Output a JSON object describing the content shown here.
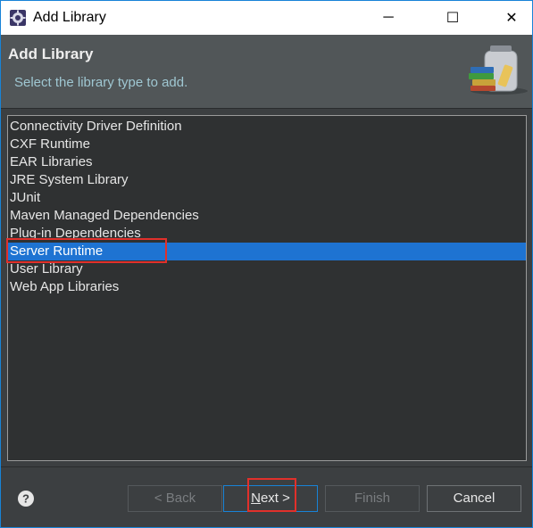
{
  "window": {
    "title": "Add Library",
    "min_glyph": "─",
    "max_glyph": "☐",
    "close_glyph": "✕"
  },
  "header": {
    "title": "Add Library",
    "description": "Select the library type to add."
  },
  "list": {
    "items": [
      {
        "label": "Connectivity Driver Definition"
      },
      {
        "label": "CXF Runtime"
      },
      {
        "label": "EAR Libraries"
      },
      {
        "label": "JRE System Library"
      },
      {
        "label": "JUnit"
      },
      {
        "label": "Maven Managed Dependencies"
      },
      {
        "label": "Plug-in Dependencies"
      },
      {
        "label": "Server Runtime"
      },
      {
        "label": "User Library"
      },
      {
        "label": "Web App Libraries"
      }
    ],
    "selected": "Server Runtime"
  },
  "buttons": {
    "help": "?",
    "back": "< Back",
    "next": "Next >",
    "finish": "Finish",
    "cancel": "Cancel"
  },
  "colors": {
    "selection": "#1e73d2",
    "callout": "#e1302b",
    "accent_border": "#1883d7"
  },
  "icons": {
    "app": "eclipse-gear-icon",
    "banner": "library-jar-books-icon",
    "help": "help-circle-icon"
  }
}
